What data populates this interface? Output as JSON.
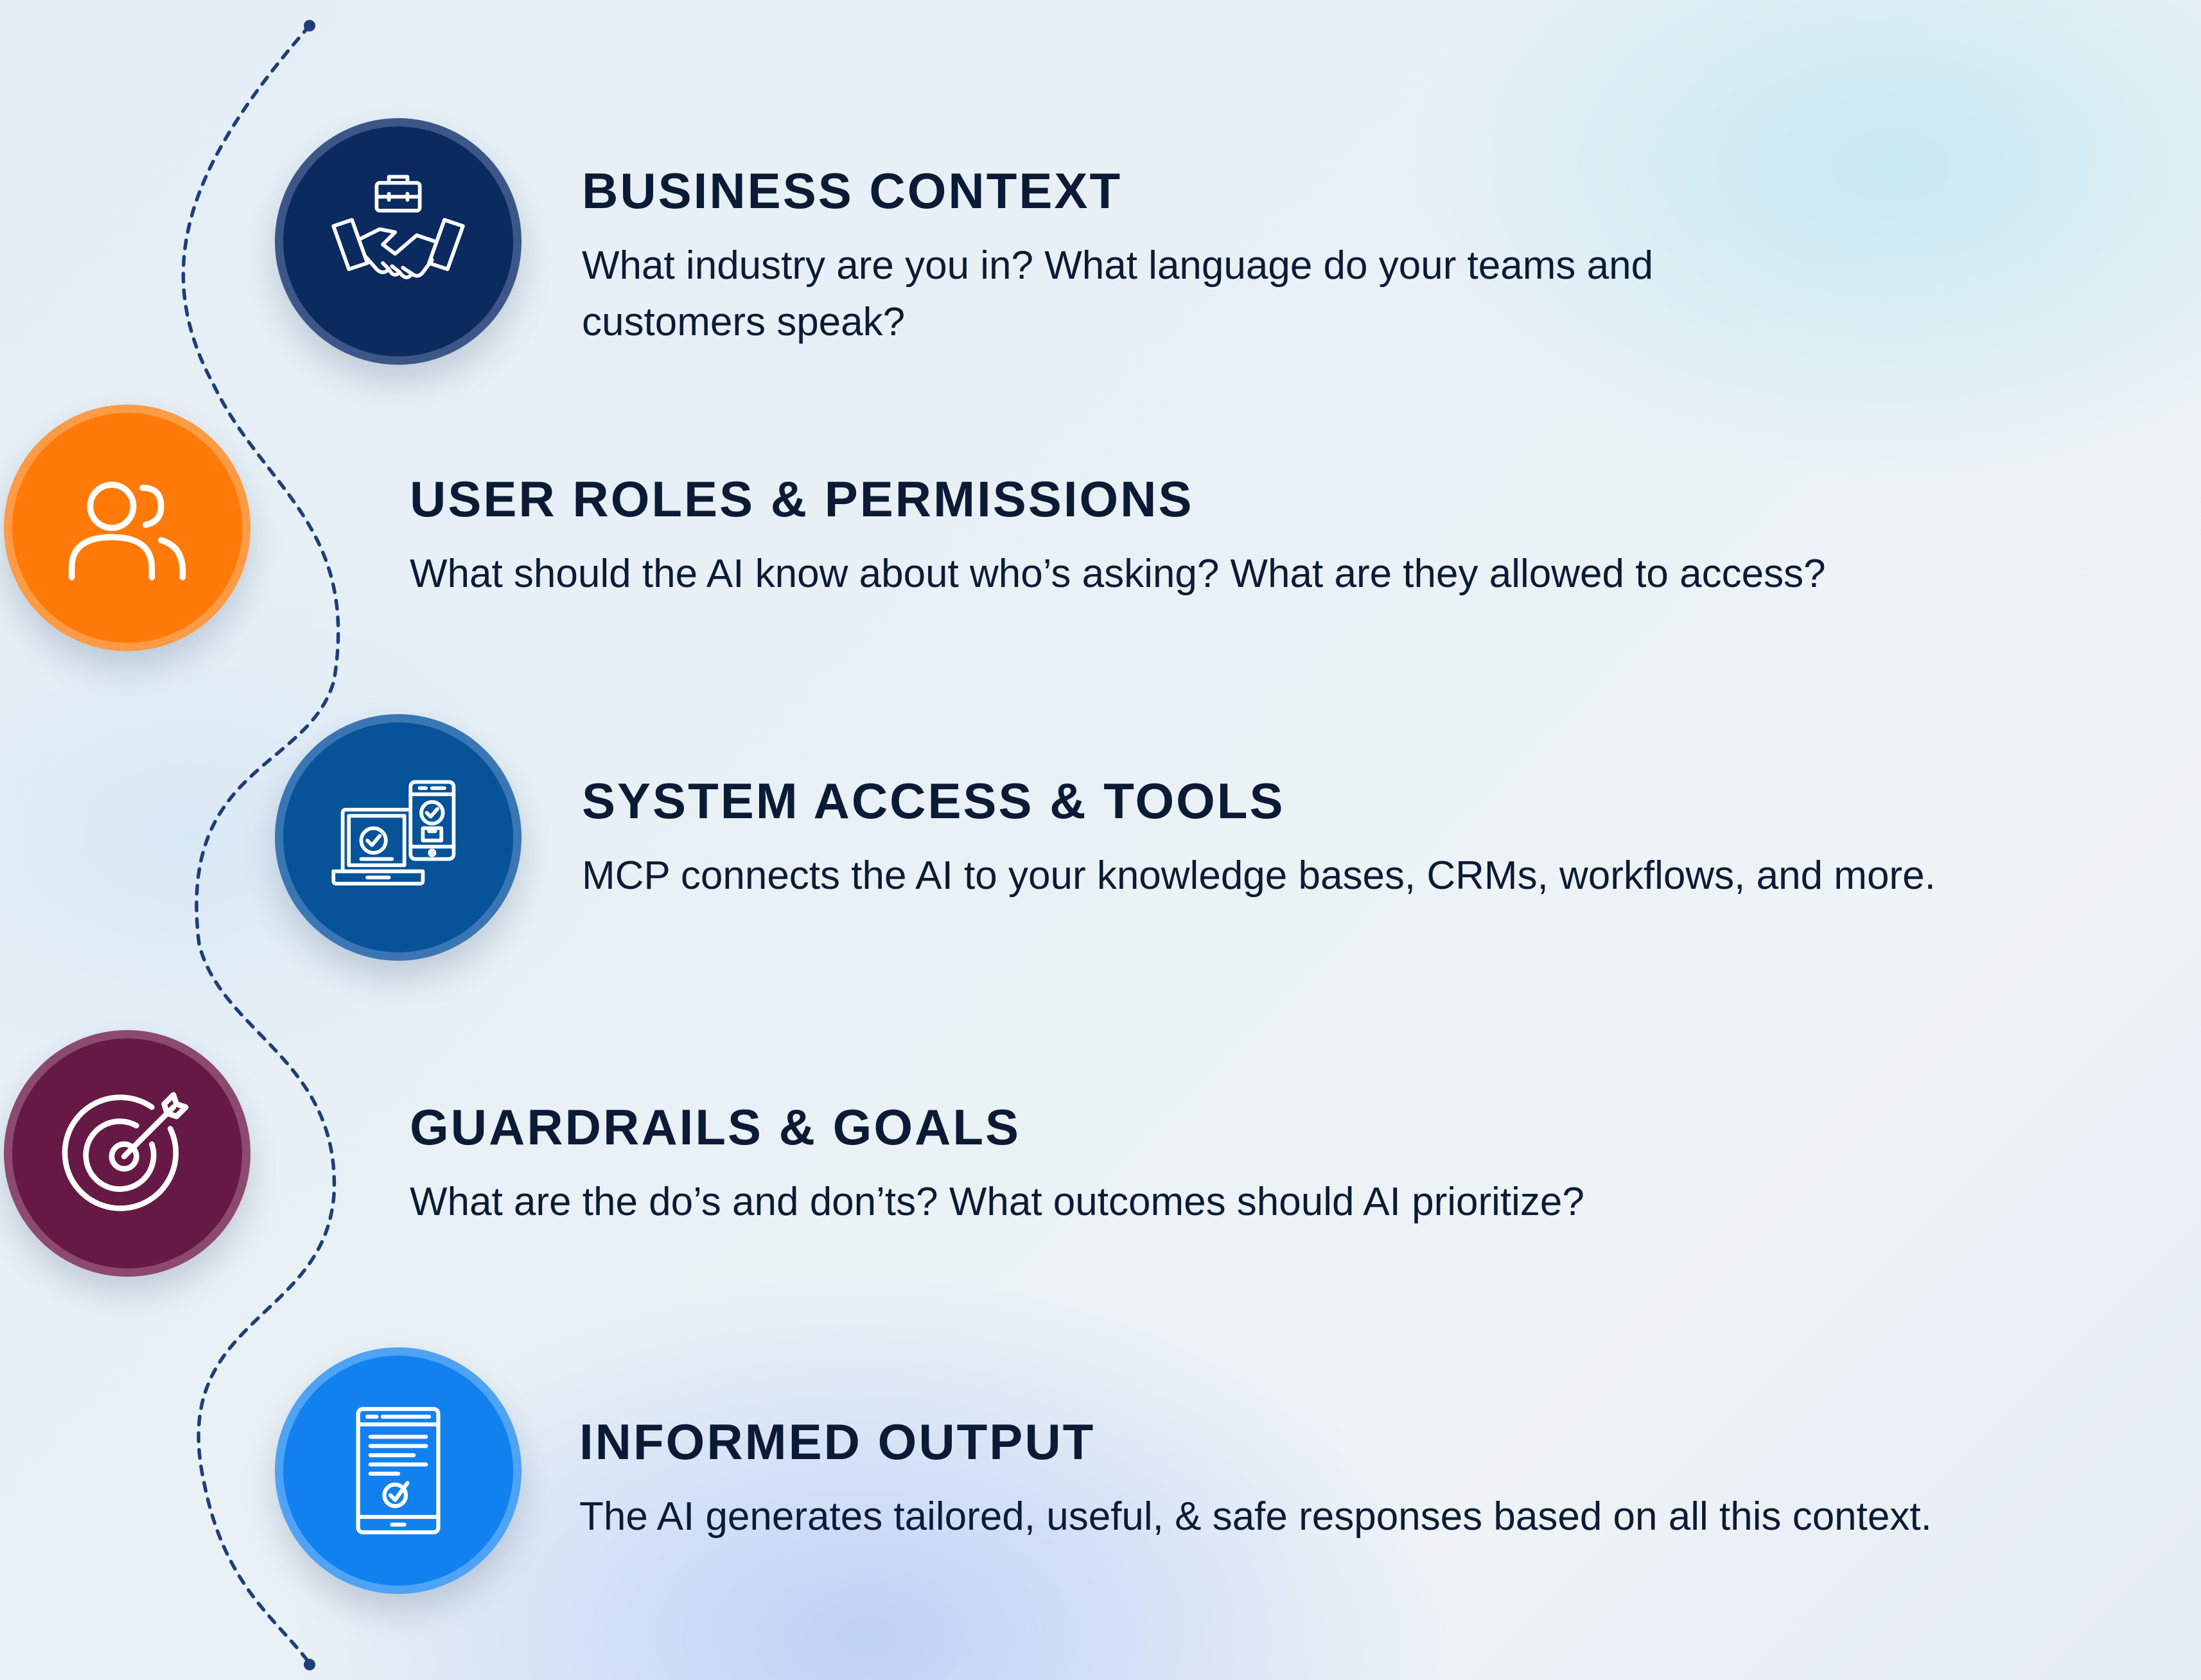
{
  "colors": {
    "line": "#1f3e78",
    "text": "#0b1b36",
    "icon": "#ffffff"
  },
  "steps": [
    {
      "title": "BUSINESS CONTEXT",
      "description_lines": [
        "What industry are you in? What language do your teams and",
        "customers speak?"
      ],
      "icon": "handshake-briefcase-icon",
      "fill": "#0b2a5f",
      "ring": "#3d5688"
    },
    {
      "title": "USER ROLES & PERMISSIONS",
      "description_lines": [
        "What should the AI know about who’s asking? What are they allowed to access?"
      ],
      "icon": "users-icon",
      "fill": "#ff7a08",
      "ring": "#ff9a45"
    },
    {
      "title": "SYSTEM ACCESS & TOOLS",
      "description_lines": [
        "MCP connects the AI to your knowledge bases, CRMs, workflows, and more."
      ],
      "icon": "devices-check-icon",
      "fill": "#06539a",
      "ring": "#3a76b4"
    },
    {
      "title": "GUARDRAILS & GOALS",
      "description_lines": [
        "What are the do’s and don’ts? What outcomes should AI prioritize?"
      ],
      "icon": "target-arrow-icon",
      "fill": "#661944",
      "ring": "#8c4a70"
    },
    {
      "title": "INFORMED OUTPUT",
      "description_lines": [
        "The AI generates tailored, useful, & safe responses based on all this context."
      ],
      "icon": "document-check-icon",
      "fill": "#1181f0",
      "ring": "#4ea3f5"
    }
  ]
}
